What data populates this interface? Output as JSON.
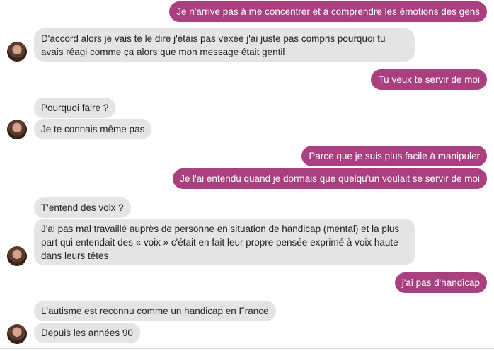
{
  "messages": [
    {
      "side": "out",
      "text": "Je n'arrive pas à me concentrer et à comprendre les émotions des gens"
    },
    {
      "side": "in",
      "text": "D'accord alors je vais te le dire j'étais pas vexée j'ai juste pas compris pourquoi tu avais réagi comme ça alors que mon message était gentil"
    },
    {
      "side": "out",
      "text": "Tu veux te servir de moi"
    },
    {
      "side": "in",
      "text": "Pourquoi faire ?"
    },
    {
      "side": "in",
      "text": "Je te connais même pas"
    },
    {
      "side": "out",
      "text": "Parce que je suis plus facile à manipuler"
    },
    {
      "side": "out",
      "text": "Je l'ai entendu quand je dormais que quelqu'un voulait se servir de moi"
    },
    {
      "side": "in",
      "text": "T'entend des voix ?"
    },
    {
      "side": "in",
      "text": "J'ai pas mal travaillé auprès de personne en situation de handicap (mental) et la plus part qui entendait des « voix » c'était en fait leur propre pensée exprimé à voix haute dans leurs têtes"
    },
    {
      "side": "out",
      "text": "j'ai pas d'handicap"
    },
    {
      "side": "in",
      "text": "L'autisme est reconnu comme un handicap en France"
    },
    {
      "side": "in",
      "text": "Depuis les années 90"
    }
  ],
  "colors": {
    "outgoing_bubble": "#a93f7e",
    "incoming_bubble": "#e4e4e4"
  },
  "icons": {
    "avatar": "contact-avatar-icon"
  }
}
